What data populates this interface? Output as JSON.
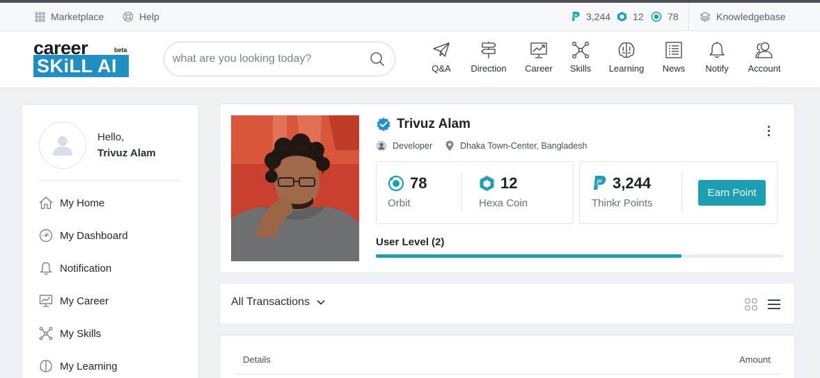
{
  "utility_bar": {
    "marketplace": "Marketplace",
    "help": "Help",
    "thinkr_points": "3,244",
    "hexa_coin": "12",
    "orbit": "78",
    "knowledgebase": "Knowledgebase"
  },
  "logo": {
    "line1": "career",
    "beta": "beta",
    "line2": "SKiLL AI"
  },
  "search": {
    "placeholder": "what are you looking today?"
  },
  "nav": {
    "qa": "Q&A",
    "direction": "Direction",
    "career": "Career",
    "skills": "Skills",
    "learning": "Learning",
    "news": "News",
    "notify": "Notify",
    "account": "Account"
  },
  "sidebar": {
    "greeting": "Hello,",
    "user_name": "Trivuz Alam",
    "items": [
      {
        "label": "My Home",
        "icon": "home-icon"
      },
      {
        "label": "My Dashboard",
        "icon": "dashboard-gauge-icon"
      },
      {
        "label": "Notification",
        "icon": "bell-icon"
      },
      {
        "label": "My Career",
        "icon": "chart-board-icon"
      },
      {
        "label": "My Skills",
        "icon": "skills-network-icon"
      },
      {
        "label": "My Learning",
        "icon": "brain-icon"
      }
    ]
  },
  "profile": {
    "name": "Trivuz Alam",
    "role": "Developer",
    "location": "Dhaka Town-Center, Bangladesh",
    "orbit_value": "78",
    "orbit_label": "Orbit",
    "hexa_value": "12",
    "hexa_label": "Hexa Coin",
    "points_value": "3,244",
    "points_label": "Thinkr Points",
    "earn_button": "Earn Point",
    "level_label": "User Level (2)",
    "level_progress": 0.75
  },
  "transactions": {
    "filter": "All Transactions",
    "col_details": "Details",
    "col_amount": "Amount"
  },
  "colors": {
    "accent": "#1a9fb3",
    "logo_blue": "#1e8fc3"
  }
}
